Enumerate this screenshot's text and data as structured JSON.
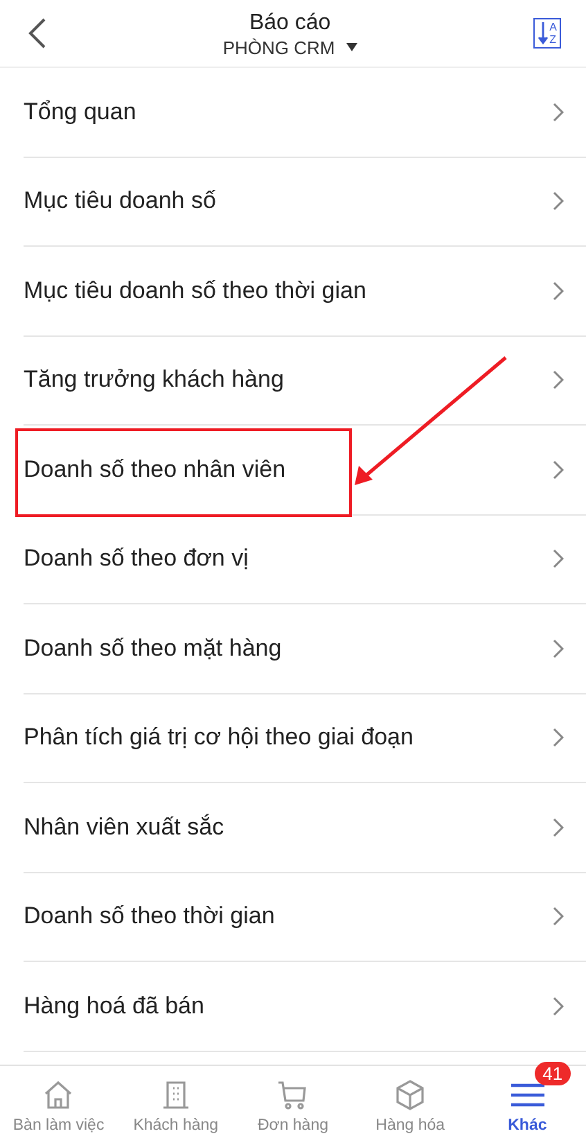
{
  "header": {
    "title": "Báo cáo",
    "subtitle": "PHÒNG CRM",
    "sort_icon": {
      "top": "A",
      "bottom": "Z"
    }
  },
  "reports": [
    {
      "label": "Tổng quan",
      "highlighted": false
    },
    {
      "label": "Mục tiêu doanh số",
      "highlighted": false
    },
    {
      "label": "Mục tiêu doanh số theo thời gian",
      "highlighted": false
    },
    {
      "label": "Tăng trưởng khách hàng",
      "highlighted": false
    },
    {
      "label": "Doanh số theo nhân viên",
      "highlighted": true
    },
    {
      "label": "Doanh số theo đơn vị",
      "highlighted": false
    },
    {
      "label": "Doanh số theo mặt hàng",
      "highlighted": false
    },
    {
      "label": "Phân tích giá trị cơ hội theo giai đoạn",
      "highlighted": false
    },
    {
      "label": "Nhân viên xuất sắc",
      "highlighted": false
    },
    {
      "label": "Doanh số theo thời gian",
      "highlighted": false
    },
    {
      "label": "Hàng hoá đã bán",
      "highlighted": false
    }
  ],
  "tab_bar": [
    {
      "kind": "home",
      "label": "Bàn làm việc",
      "selected": false
    },
    {
      "kind": "building",
      "label": "Khách hàng",
      "selected": false
    },
    {
      "kind": "cart",
      "label": "Đơn hàng",
      "selected": false
    },
    {
      "kind": "box",
      "label": "Hàng hóa",
      "selected": false
    },
    {
      "kind": "menu",
      "label": "Khác",
      "selected": true,
      "badge": "41"
    }
  ]
}
